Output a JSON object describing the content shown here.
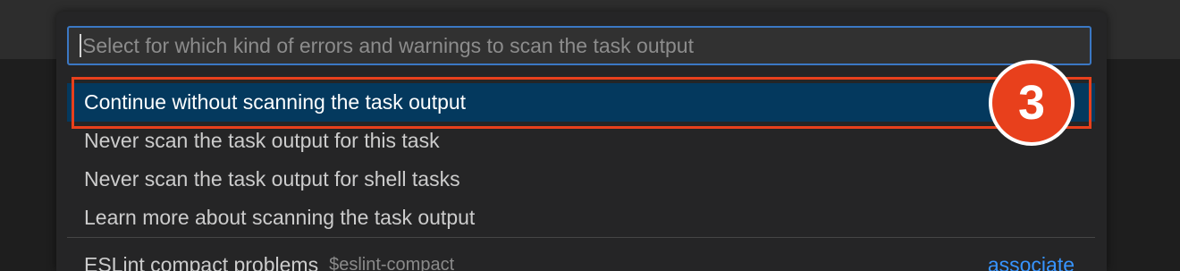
{
  "quick_pick": {
    "placeholder": "Select for which kind of errors and warnings to scan the task output",
    "items": [
      {
        "label": "Continue without scanning the task output",
        "selected": true
      },
      {
        "label": "Never scan the task output for this task",
        "selected": false
      },
      {
        "label": "Never scan the task output for shell tasks",
        "selected": false
      },
      {
        "label": "Learn more about scanning the task output",
        "selected": false
      }
    ],
    "matcher_item": {
      "label": "ESLint compact problems",
      "detail": "$eslint-compact",
      "action": "associate"
    }
  },
  "annotation": {
    "step_number": "3",
    "color": "#e8401c"
  },
  "colors": {
    "selection_background": "#04395e",
    "focus_border": "#3b78c4",
    "link": "#3794ff"
  }
}
